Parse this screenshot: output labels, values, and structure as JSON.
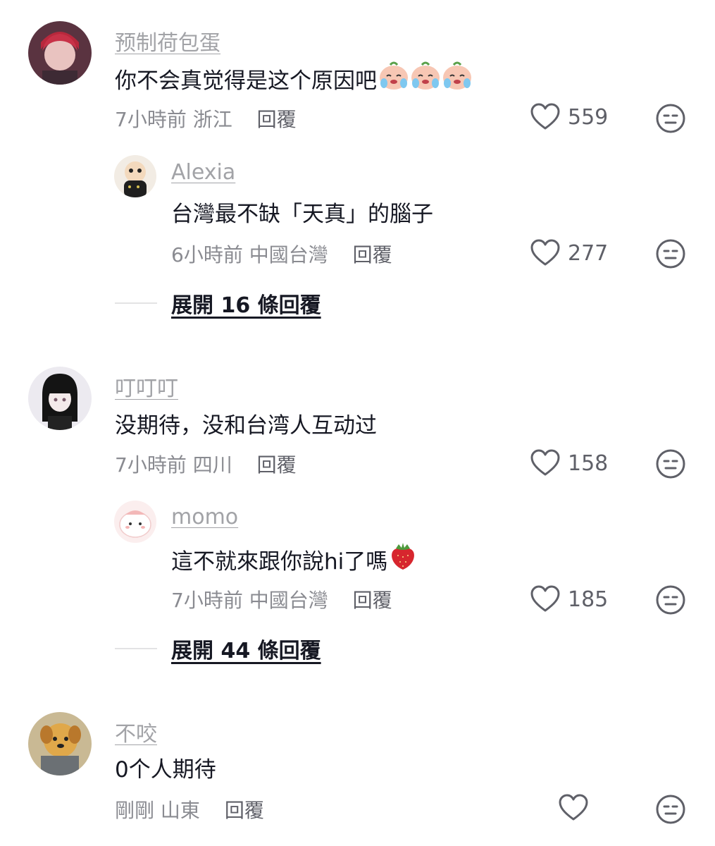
{
  "comments": [
    {
      "username": "预制荷包蛋",
      "text": "你不会真觉得是这个原因吧",
      "time": "7小時前",
      "location": "浙江",
      "reply_label": "回覆",
      "likes": "559",
      "emoji": "crying-peach-emoji",
      "replies": [
        {
          "username": "Alexia",
          "text": "台灣最不缺「天真」的腦子",
          "time": "6小時前",
          "location": "中國台灣",
          "reply_label": "回覆",
          "likes": "277"
        }
      ],
      "expand_label": "展開 16 條回覆"
    },
    {
      "username": "叮叮叮",
      "text": "没期待，没和台湾人互动过",
      "time": "7小時前",
      "location": "四川",
      "reply_label": "回覆",
      "likes": "158",
      "replies": [
        {
          "username": "momo",
          "text": "這不就來跟你說hi了嗎",
          "time": "7小時前",
          "location": "中國台灣",
          "reply_label": "回覆",
          "likes": "185",
          "emoji": "strawberry-emoji"
        }
      ],
      "expand_label": "展開 44 條回覆"
    },
    {
      "username": "不咬",
      "text": "0个人期待",
      "time": "剛剛",
      "location": "山東",
      "reply_label": "回覆",
      "likes": ""
    }
  ],
  "icons": {
    "like": "heart-outline-icon",
    "dislike": "neutral-face-icon"
  },
  "colors": {
    "username": "#a2a3a7",
    "meta": "#8a8b91",
    "text": "#161823"
  }
}
